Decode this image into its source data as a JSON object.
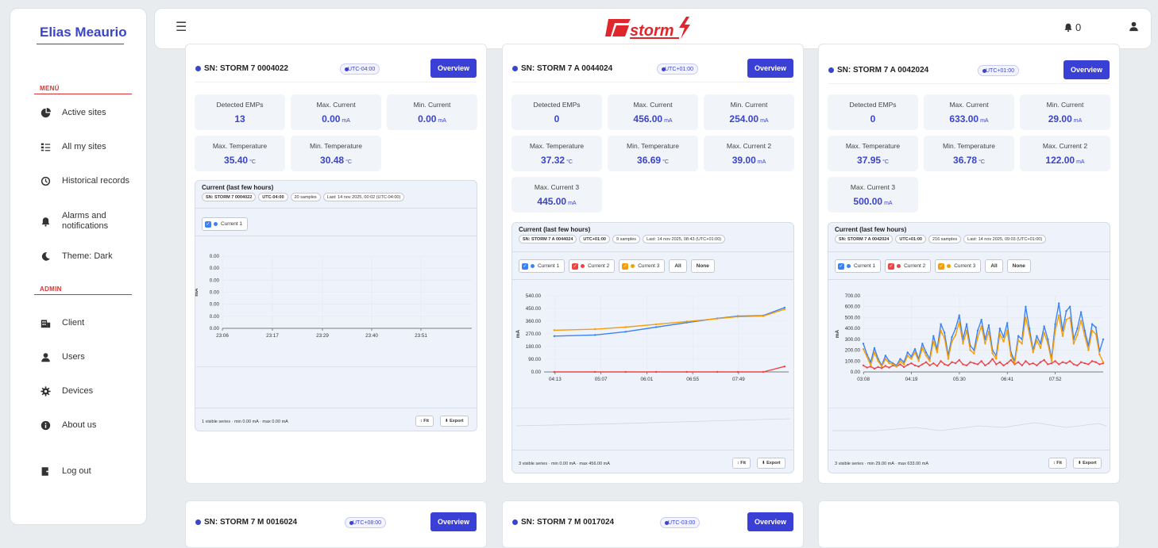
{
  "sidebar": {
    "user_name": "Elias Meaurio",
    "menu_label": "MENÚ",
    "admin_label": "ADMIN",
    "menu_items": [
      {
        "label": "Active sites",
        "icon": "pie-chart-icon"
      },
      {
        "label": "All my sites",
        "icon": "list-icon"
      },
      {
        "label": "Historical records",
        "icon": "history-icon"
      },
      {
        "label": "Alarms and notifications",
        "icon": "bell-icon"
      },
      {
        "label": "Theme: Dark",
        "icon": "moon-icon"
      }
    ],
    "admin_items": [
      {
        "label": "Client",
        "icon": "building-icon"
      },
      {
        "label": "Users",
        "icon": "users-icon"
      },
      {
        "label": "Devices",
        "icon": "cog-icon"
      },
      {
        "label": "About us",
        "icon": "info-icon"
      }
    ],
    "logout_label": "Log out"
  },
  "topbar": {
    "menu_icon": "hamburger-icon",
    "logo_text": "storm",
    "notification_count": "0",
    "accent": "#3a3fd6",
    "logo_color": "#e0262d"
  },
  "cards": [
    {
      "sn": "SN: STORM 7 0004022",
      "tz": "UTC-04:00",
      "overview": "Overview",
      "metrics": [
        {
          "label": "Detected EMPs",
          "value": "13",
          "unit": ""
        },
        {
          "label": "Max. Current",
          "value": "0.00",
          "unit": "mA"
        },
        {
          "label": "Min. Current",
          "value": "0.00",
          "unit": "mA"
        },
        {
          "label": "Max. Temperature",
          "value": "35.40",
          "unit": "°C"
        },
        {
          "label": "Min. Temperature",
          "value": "30.48",
          "unit": "°C"
        }
      ],
      "chart": {
        "title": "Current (last few hours)",
        "chips": [
          "SN: STORM 7 0004022",
          "UTC-04:00",
          "20 samples",
          "Last: 14 nov 2025, 00:02 (UTC-04:00)"
        ],
        "legend": [
          "Current 1"
        ],
        "footer": "1 visible series · min 0.00 mA · max 0.00 mA",
        "fit": "↕ Fit",
        "export": "⬇ Export"
      }
    },
    {
      "sn": "SN: STORM 7 A 0044024",
      "tz": "UTC+01:00",
      "overview": "Overview",
      "metrics": [
        {
          "label": "Detected EMPs",
          "value": "0",
          "unit": ""
        },
        {
          "label": "Max. Current",
          "value": "456.00",
          "unit": "mA"
        },
        {
          "label": "Min. Current",
          "value": "254.00",
          "unit": "mA"
        },
        {
          "label": "Max. Temperature",
          "value": "37.32",
          "unit": "°C"
        },
        {
          "label": "Min. Temperature",
          "value": "36.69",
          "unit": "°C"
        },
        {
          "label": "Max. Current 2",
          "value": "39.00",
          "unit": "mA"
        },
        {
          "label": "Max. Current 3",
          "value": "445.00",
          "unit": "mA"
        }
      ],
      "chart": {
        "title": "Current (last few hours)",
        "chips": [
          "SN: STORM 7 A 0044024",
          "UTC+01:00",
          "9 samples",
          "Last: 14 nov 2025, 08:43 (UTC+01:00)"
        ],
        "legend": [
          "Current 1",
          "Current 2",
          "Current 3"
        ],
        "buttons": [
          "All",
          "None"
        ],
        "footer": "3 visible series · min 0.00 mA · max 456.00 mA",
        "fit": "↕ Fit",
        "export": "⬇ Export"
      }
    },
    {
      "sn": "SN: STORM 7 A 0042024",
      "tz": "UTC+01:00",
      "overview": "Overview",
      "metrics": [
        {
          "label": "Detected EMPs",
          "value": "0",
          "unit": ""
        },
        {
          "label": "Max. Current",
          "value": "633.00",
          "unit": "mA"
        },
        {
          "label": "Min. Current",
          "value": "29.00",
          "unit": "mA"
        },
        {
          "label": "Max. Temperature",
          "value": "37.95",
          "unit": "°C"
        },
        {
          "label": "Min. Temperature",
          "value": "36.78",
          "unit": "°C"
        },
        {
          "label": "Max. Current 2",
          "value": "122.00",
          "unit": "mA"
        },
        {
          "label": "Max. Current 3",
          "value": "500.00",
          "unit": "mA"
        }
      ],
      "chart": {
        "title": "Current (last few hours)",
        "chips": [
          "SN: STORM 7 A 0042024",
          "UTC+01:00",
          "216 samples",
          "Last: 14 nov 2025, 09:03 (UTC+01:00)"
        ],
        "legend": [
          "Current 1",
          "Current 2",
          "Current 3"
        ],
        "buttons": [
          "All",
          "None"
        ],
        "footer": "3 visible series · min 29.00 mA · max 633.00 mA",
        "fit": "↕ Fit",
        "export": "⬇ Export"
      }
    },
    {
      "sn": "SN: STORM 7 M 0016024",
      "tz": "UTC+08:00",
      "overview": "Overview"
    },
    {
      "sn": "SN: STORM 7 M 0017024",
      "tz": "UTC-03:00",
      "overview": "Overview"
    }
  ],
  "chart_data": [
    {
      "type": "line",
      "title": "Current (last few hours)",
      "ylabel": "mA",
      "x_ticks": [
        "23:06",
        "23:17",
        "23:29",
        "23:40",
        "23:51"
      ],
      "y_ticks": [
        "0.00",
        "0.00",
        "0.00",
        "0.00",
        "0.00",
        "0.00",
        "0.00"
      ],
      "ylim": [
        0,
        1
      ],
      "series": [
        {
          "name": "Current 1",
          "color": "#3b82f6",
          "values": []
        }
      ]
    },
    {
      "type": "line",
      "title": "Current (last few hours)",
      "ylabel": "mA",
      "x_ticks": [
        "04:13",
        "05:07",
        "06:01",
        "06:55",
        "07:49"
      ],
      "y_ticks": [
        "0.00",
        "90.00",
        "180.00",
        "270.00",
        "360.00",
        "450.00",
        "540.00"
      ],
      "ylim": [
        0,
        540
      ],
      "x_hours": [
        4.2,
        5.0,
        5.6,
        6.2,
        6.8,
        7.4,
        7.8,
        8.3,
        8.72
      ],
      "series": [
        {
          "name": "Current 1",
          "color": "#3b82f6",
          "values": [
            254,
            262,
            285,
            318,
            350,
            380,
            396,
            400,
            456
          ]
        },
        {
          "name": "Current 2",
          "color": "#ef4444",
          "values": [
            0,
            0,
            0,
            0,
            0,
            0,
            0,
            0,
            39
          ]
        },
        {
          "name": "Current 3",
          "color": "#f59e0b",
          "values": [
            296,
            303,
            318,
            338,
            358,
            378,
            392,
            396,
            445
          ]
        }
      ]
    },
    {
      "type": "line",
      "title": "Current (last few hours)",
      "ylabel": "mA",
      "x_ticks": [
        "03:08",
        "04:19",
        "05:30",
        "06:41",
        "07:52"
      ],
      "y_ticks": [
        "0.00",
        "100.00",
        "200.00",
        "300.00",
        "400.00",
        "500.00",
        "600.00",
        "700.00"
      ],
      "ylim": [
        0,
        700
      ],
      "x_start_hour": 3.13,
      "x_end_hour": 9.05,
      "series": [
        {
          "name": "Current 1",
          "color": "#3b82f6",
          "values": [
            260,
            160,
            90,
            220,
            120,
            60,
            150,
            100,
            80,
            60,
            120,
            90,
            180,
            140,
            210,
            120,
            260,
            180,
            120,
            330,
            210,
            440,
            360,
            150,
            320,
            400,
            520,
            300,
            440,
            240,
            200,
            380,
            480,
            300,
            430,
            200,
            150,
            400,
            320,
            450,
            180,
            100,
            330,
            300,
            600,
            400,
            200,
            330,
            260,
            420,
            300,
            120,
            440,
            630,
            380,
            560,
            600,
            300,
            400,
            550,
            380,
            240,
            440,
            410,
            190,
            300
          ]
        },
        {
          "name": "Current 2",
          "color": "#ef4444",
          "values": [
            60,
            40,
            50,
            30,
            45,
            35,
            55,
            40,
            60,
            50,
            70,
            45,
            65,
            80,
            60,
            50,
            70,
            90,
            60,
            80,
            55,
            100,
            70,
            60,
            90,
            80,
            110,
            70,
            60,
            90,
            80,
            70,
            100,
            60,
            80,
            120,
            70,
            90,
            60,
            80,
            110,
            70,
            90,
            60,
            100,
            70,
            80,
            60,
            90,
            110,
            70,
            80,
            100,
            70,
            90,
            80,
            100,
            70,
            60,
            90,
            80,
            70,
            100,
            90,
            70,
            80
          ]
        },
        {
          "name": "Current 3",
          "color": "#f59e0b",
          "values": [
            210,
            140,
            60,
            180,
            100,
            50,
            120,
            80,
            70,
            50,
            100,
            70,
            150,
            120,
            180,
            100,
            220,
            150,
            100,
            280,
            180,
            380,
            310,
            120,
            280,
            340,
            460,
            260,
            380,
            200,
            170,
            320,
            420,
            260,
            370,
            170,
            120,
            350,
            280,
            380,
            150,
            80,
            290,
            260,
            500,
            350,
            180,
            290,
            220,
            360,
            260,
            100,
            380,
            520,
            330,
            480,
            500,
            260,
            340,
            470,
            330,
            200,
            380,
            350,
            160,
            90
          ]
        }
      ]
    }
  ]
}
